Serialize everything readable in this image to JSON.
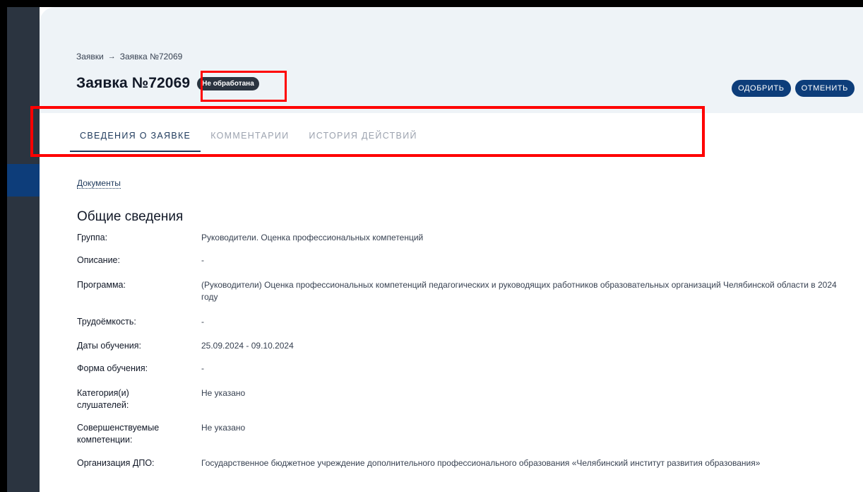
{
  "breadcrumb": {
    "root": "Заявки",
    "separator": "→",
    "current": "Заявка №72069"
  },
  "page": {
    "title": "Заявка №72069",
    "status": "Не обработана"
  },
  "actions": {
    "approve": "одобрить",
    "cancel": "отменить"
  },
  "tabs": [
    {
      "label": "Сведения о заявке",
      "active": true
    },
    {
      "label": "Комментарии",
      "active": false
    },
    {
      "label": "История действий",
      "active": false
    }
  ],
  "documents_link": "Документы",
  "section": {
    "title": "Общие сведения"
  },
  "info": [
    {
      "label": "Группа:",
      "value": "Руководители. Оценка профессиональных компетенций"
    },
    {
      "label": "Описание:",
      "value": "-"
    },
    {
      "label": "Программа:",
      "value": "(Руководители) Оценка профессиональных компетенций педагогических и руководящих работников образовательных организаций Челябинской области в 2024 году"
    },
    {
      "label": "Трудоёмкость:",
      "value": "-"
    },
    {
      "label": "Даты обучения:",
      "value": "25.09.2024 - 09.10.2024"
    },
    {
      "label": "Форма обучения:",
      "value": "-"
    },
    {
      "label": "Категория(и) слушателей:",
      "value": "Не указано"
    },
    {
      "label": "Совершенствуемые компетенции:",
      "value": "Не указано"
    },
    {
      "label": "Организация ДПО:",
      "value": "Государственное бюджетное учреждение дополнительного профессионального образования «Челябинский институт развития образования»"
    }
  ],
  "colors": {
    "accent": "#0d3d7a",
    "sidebar": "#2b3440",
    "highlight": "#ff0000"
  }
}
